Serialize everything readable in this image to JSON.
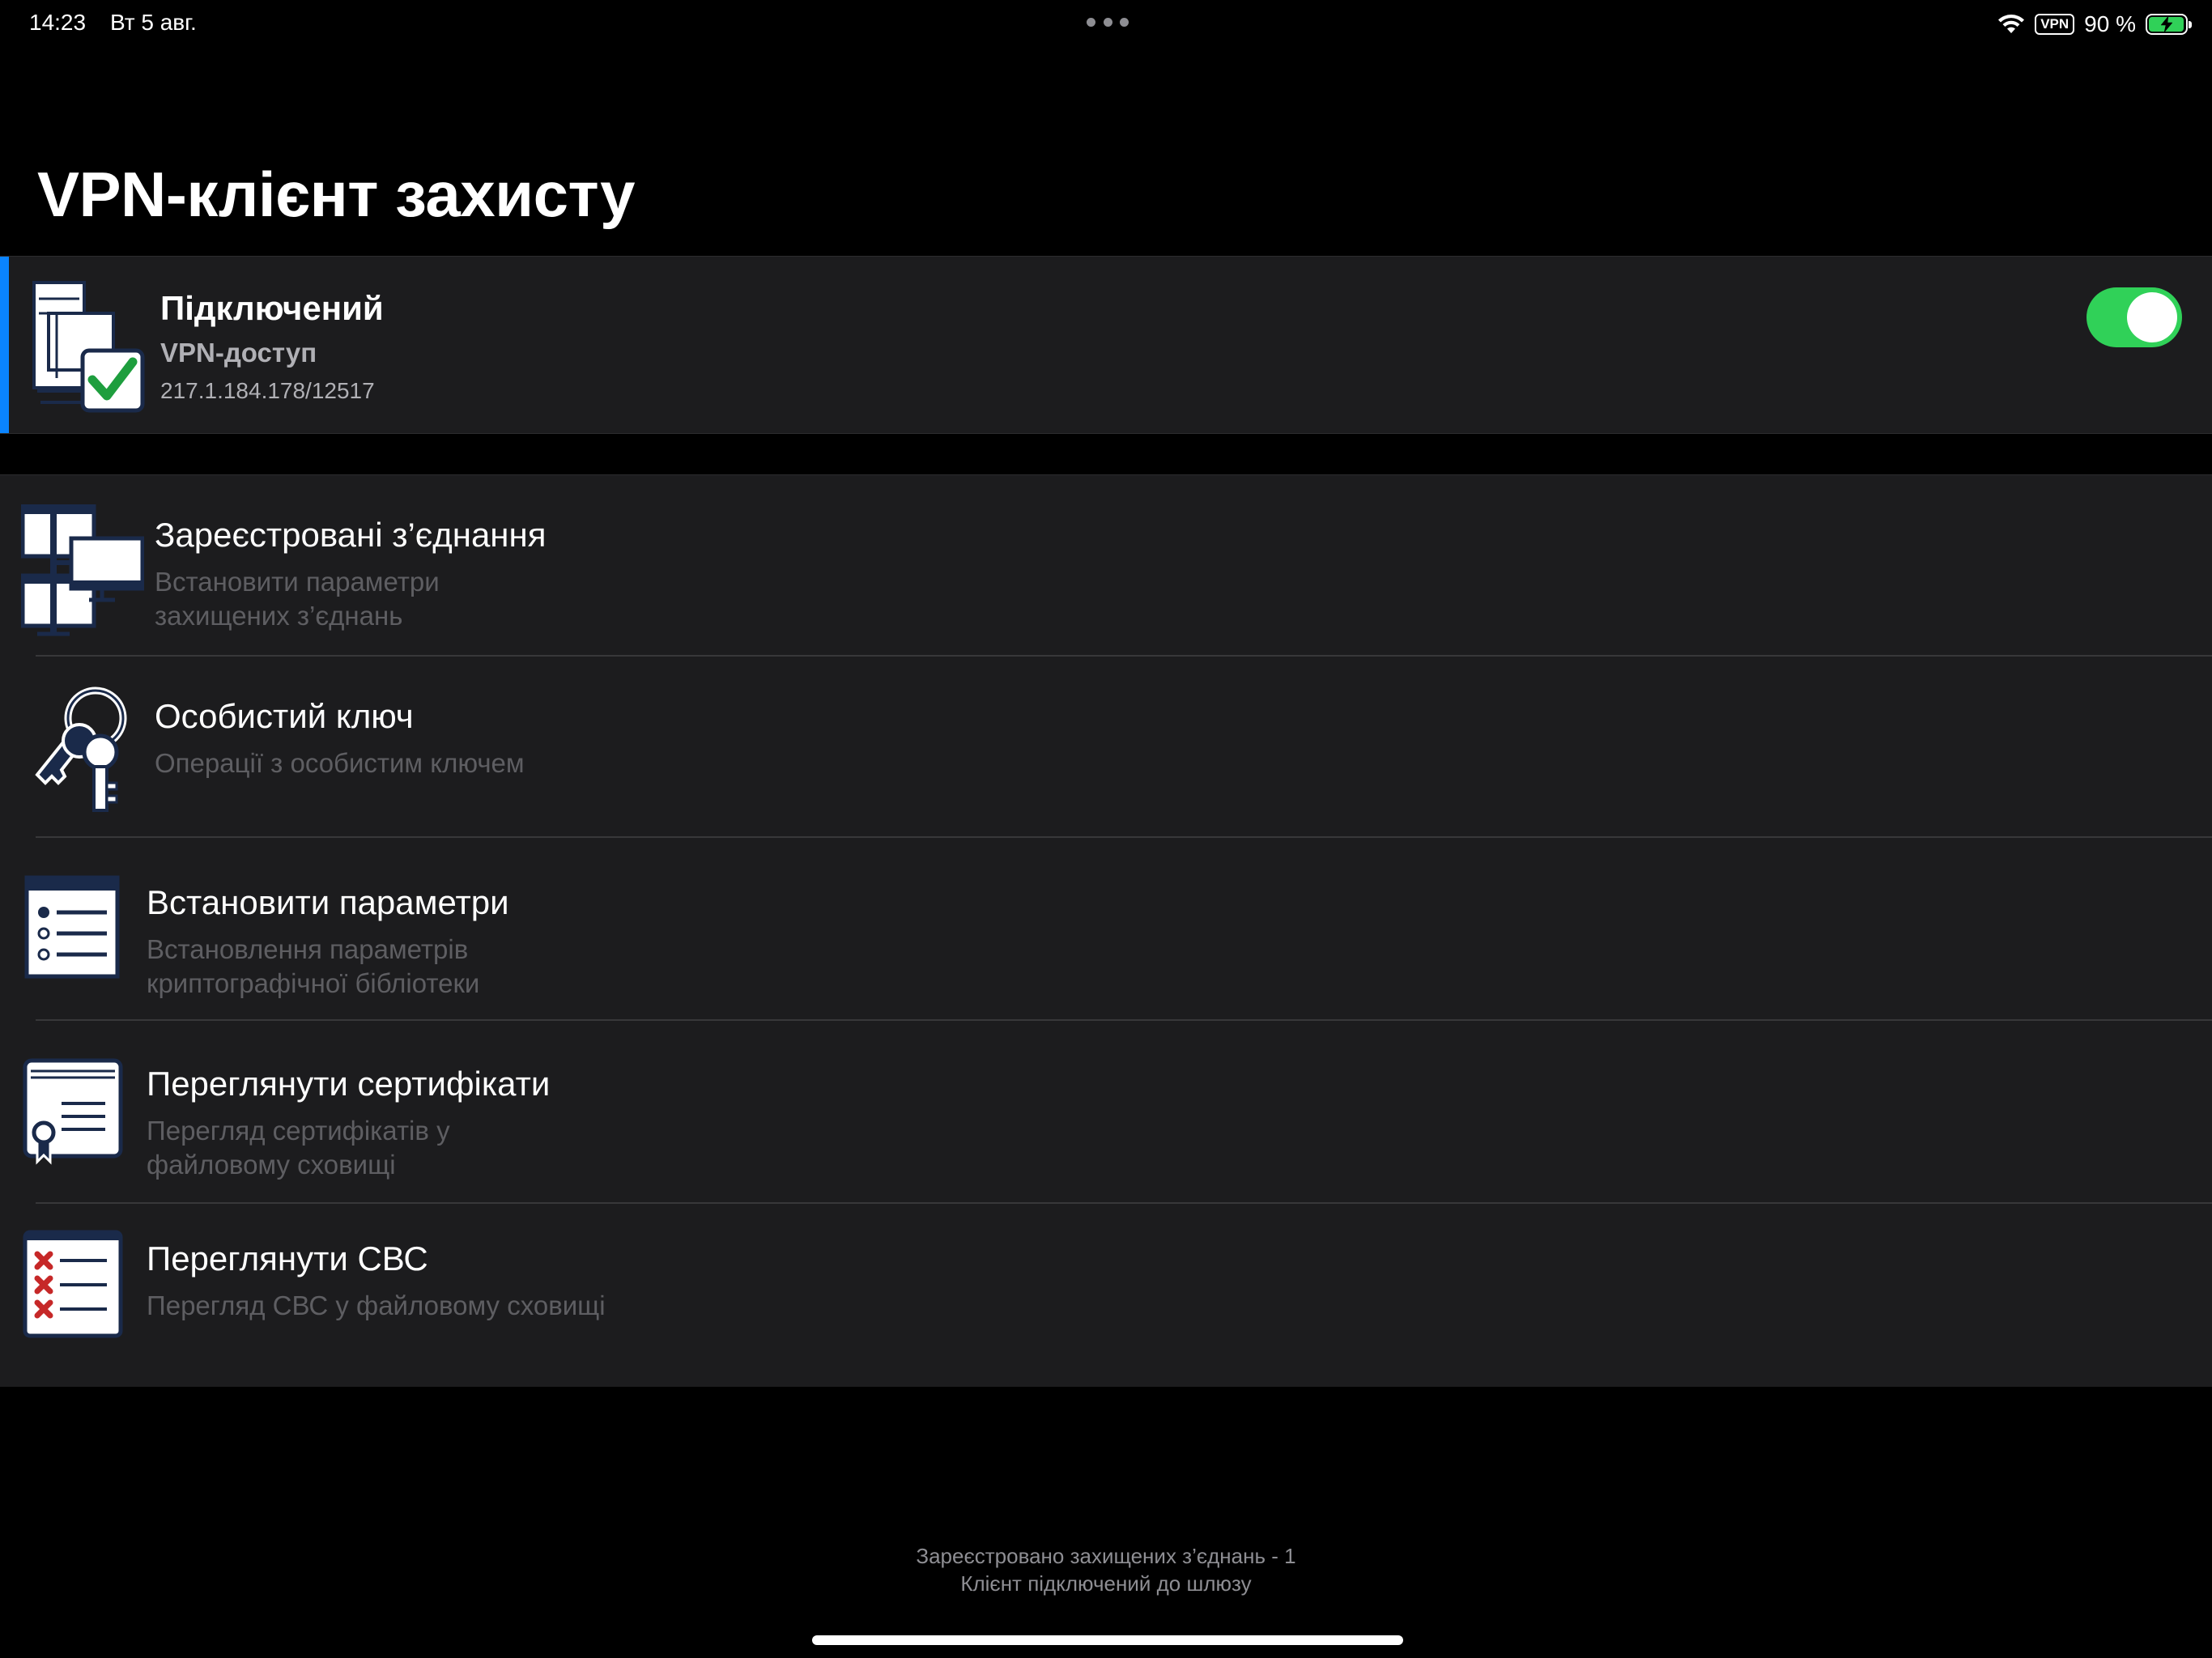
{
  "status_bar": {
    "time": "14:23",
    "date": "Вт 5 авг.",
    "vpn_badge": "VPN",
    "battery": "90 %",
    "icons": [
      "wifi-icon",
      "vpn-icon",
      "battery-charging-icon"
    ]
  },
  "page_title": "VPN-клієнт захисту",
  "connection": {
    "status": "Підключений",
    "type": "VPN-доступ",
    "address": "217.1.184.178/12517",
    "enabled": true,
    "accent_color": "#0a84ff",
    "toggle_color": "#30d158",
    "icon": "connected-computers-check-icon"
  },
  "menu": [
    {
      "title": "Зареєстровані з’єднання",
      "subtitle": "Встановити параметри\nзахищених з’єднань",
      "icon": "network-computers-icon"
    },
    {
      "title": "Особистий ключ",
      "subtitle": "Операції з особистим ключем",
      "icon": "keys-icon"
    },
    {
      "title": "Встановити параметри",
      "subtitle": "Встановлення параметрів\nкриптографічної бібліотеки",
      "icon": "settings-list-icon"
    },
    {
      "title": "Переглянути сертифікати",
      "subtitle": "Перегляд сертифікатів у\nфайловому сховищі",
      "icon": "certificate-icon"
    },
    {
      "title": "Переглянути СВС",
      "subtitle": "Перегляд СВС у файловому сховищі",
      "icon": "revocation-list-icon"
    }
  ],
  "footer": {
    "line1": "Зареєстровано захищених з’єднань - 1",
    "line2": "Клієнт підключений до шлюзу"
  }
}
